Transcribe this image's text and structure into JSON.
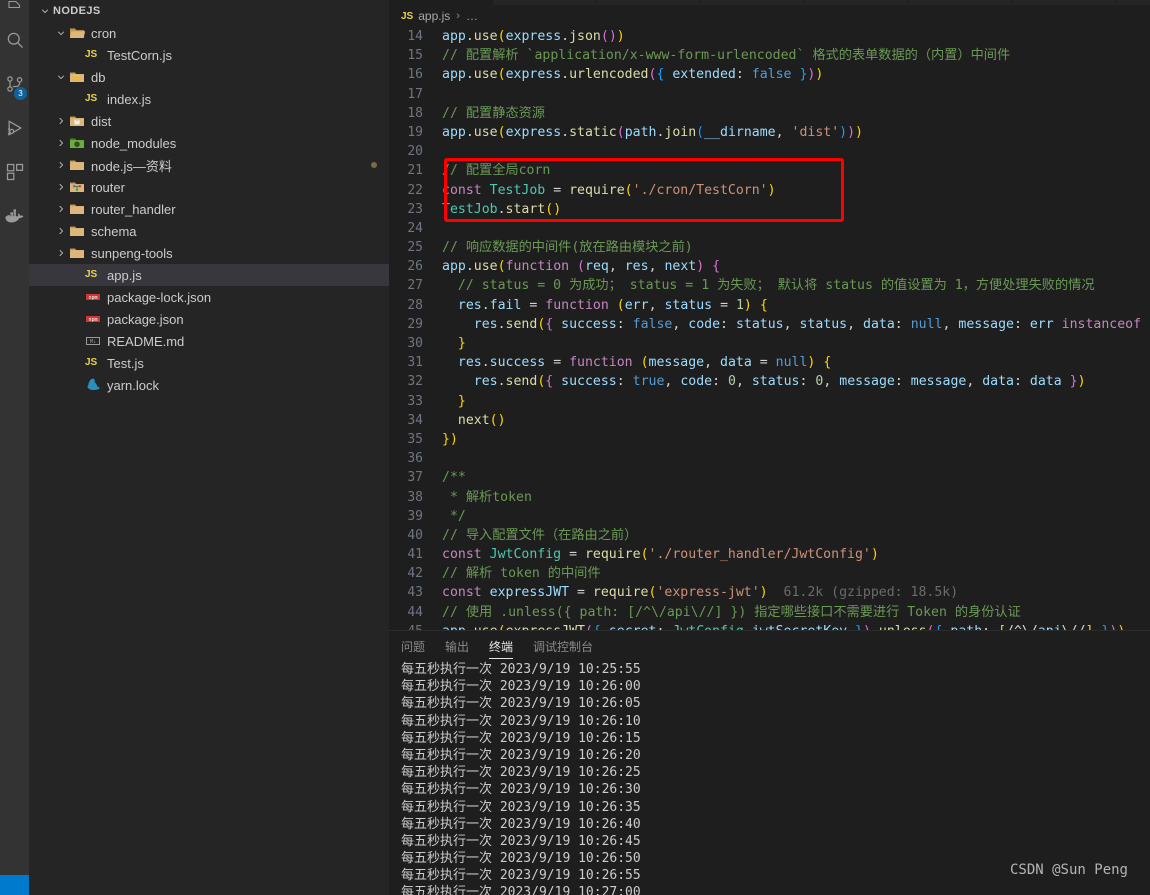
{
  "activity_bar": {
    "items": [
      {
        "name": "explorer-icon",
        "glyph": "files"
      },
      {
        "name": "search-icon",
        "glyph": "search"
      },
      {
        "name": "source-control-icon",
        "glyph": "git",
        "badge": "3"
      },
      {
        "name": "run-debug-icon",
        "glyph": "debug"
      },
      {
        "name": "extensions-icon",
        "glyph": "extensions"
      },
      {
        "name": "docker-icon",
        "glyph": "docker"
      }
    ]
  },
  "sidebar": {
    "section_title": "NODEJS",
    "tree": [
      {
        "label": "cron",
        "type": "folder",
        "expanded": true,
        "indent": 1,
        "icon": "folder-open-icon"
      },
      {
        "label": "TestCorn.js",
        "type": "js",
        "indent": 2,
        "icon": "js-icon"
      },
      {
        "label": "db",
        "type": "folder",
        "expanded": true,
        "indent": 1,
        "icon": "folder-db-icon"
      },
      {
        "label": "index.js",
        "type": "js",
        "indent": 2,
        "icon": "js-icon"
      },
      {
        "label": "dist",
        "type": "folder",
        "expanded": false,
        "indent": 1,
        "icon": "folder-dist-icon"
      },
      {
        "label": "node_modules",
        "type": "folder",
        "expanded": false,
        "indent": 1,
        "icon": "folder-node-icon"
      },
      {
        "label": "node.js—资料",
        "type": "folder",
        "expanded": false,
        "indent": 1,
        "icon": "folder-icon",
        "dot": true
      },
      {
        "label": "router",
        "type": "folder",
        "expanded": false,
        "indent": 1,
        "icon": "folder-router-icon"
      },
      {
        "label": "router_handler",
        "type": "folder",
        "expanded": false,
        "indent": 1,
        "icon": "folder-icon"
      },
      {
        "label": "schema",
        "type": "folder",
        "expanded": false,
        "indent": 1,
        "icon": "folder-icon"
      },
      {
        "label": "sunpeng-tools",
        "type": "folder",
        "expanded": false,
        "indent": 1,
        "icon": "folder-icon"
      },
      {
        "label": "app.js",
        "type": "js",
        "indent": 2,
        "icon": "js-icon",
        "selected": true
      },
      {
        "label": "package-lock.json",
        "type": "npm",
        "indent": 2,
        "icon": "npm-icon"
      },
      {
        "label": "package.json",
        "type": "npm",
        "indent": 2,
        "icon": "npm-icon"
      },
      {
        "label": "README.md",
        "type": "md",
        "indent": 2,
        "icon": "markdown-icon"
      },
      {
        "label": "Test.js",
        "type": "js",
        "indent": 2,
        "icon": "js-icon"
      },
      {
        "label": "yarn.lock",
        "type": "yarn",
        "indent": 2,
        "icon": "yarn-icon"
      }
    ]
  },
  "editor": {
    "breadcrumb": {
      "file_icon": "JS",
      "file": "app.js",
      "separator": "›",
      "rest": "…"
    },
    "first_line_number": 14,
    "lines": [
      {
        "n": 14,
        "text": "app.use(express.json())"
      },
      {
        "n": 15,
        "text": "// 配置解析 `application/x-www-form-urlencoded` 格式的表单数据的（内置）中间件"
      },
      {
        "n": 16,
        "text": "app.use(express.urlencoded({ extended: false }))"
      },
      {
        "n": 17,
        "text": ""
      },
      {
        "n": 18,
        "text": "// 配置静态资源"
      },
      {
        "n": 19,
        "text": "app.use(express.static(path.join(__dirname, 'dist')))"
      },
      {
        "n": 20,
        "text": ""
      },
      {
        "n": 21,
        "text": "// 配置全局corn"
      },
      {
        "n": 22,
        "text": "const TestJob = require('./cron/TestCorn')"
      },
      {
        "n": 23,
        "text": "TestJob.start()"
      },
      {
        "n": 24,
        "text": ""
      },
      {
        "n": 25,
        "text": "// 响应数据的中间件(放在路由模块之前)"
      },
      {
        "n": 26,
        "text": "app.use(function (req, res, next) {"
      },
      {
        "n": 27,
        "text": "  // status = 0 为成功； status = 1 为失败； 默认将 status 的值设置为 1，方便处理失败的情况"
      },
      {
        "n": 28,
        "text": "  res.fail = function (err, status = 1) {"
      },
      {
        "n": 29,
        "text": "    res.send({ success: false, code: status, status, data: null, message: err instanceof E"
      },
      {
        "n": 30,
        "text": "  }"
      },
      {
        "n": 31,
        "text": "  res.success = function (message, data = null) {"
      },
      {
        "n": 32,
        "text": "    res.send({ success: true, code: 0, status: 0, message: message, data: data })"
      },
      {
        "n": 33,
        "text": "  }"
      },
      {
        "n": 34,
        "text": "  next()"
      },
      {
        "n": 35,
        "text": "})"
      },
      {
        "n": 36,
        "text": ""
      },
      {
        "n": 37,
        "text": "/**"
      },
      {
        "n": 38,
        "text": " * 解析token"
      },
      {
        "n": 39,
        "text": " */"
      },
      {
        "n": 40,
        "text": "// 导入配置文件（在路由之前）"
      },
      {
        "n": 41,
        "text": "const JwtConfig = require('./router_handler/JwtConfig')"
      },
      {
        "n": 42,
        "text": "// 解析 token 的中间件"
      },
      {
        "n": 43,
        "text": "const expressJWT = require('express-jwt')  61.2k (gzipped: 18.5k)"
      },
      {
        "n": 44,
        "text": "// 使用 .unless({ path: [/^\\/api\\//] }) 指定哪些接口不需要进行 Token 的身份认证"
      },
      {
        "n": 45,
        "text": "app.use(expressJWT({ secret: JwtConfig.jwtSecretKey }).unless({ path: [/^\\/api\\//] }))"
      }
    ],
    "annotation": {
      "name": "red-highlight-box",
      "color": "#ff0000",
      "covers_lines": "21-23"
    }
  },
  "panel": {
    "tabs": [
      {
        "label": "问题",
        "active": false
      },
      {
        "label": "输出",
        "active": false
      },
      {
        "label": "终端",
        "active": true
      },
      {
        "label": "调试控制台",
        "active": false
      }
    ],
    "terminal_lines": [
      "每五秒执行一次 2023/9/19 10:25:55",
      "每五秒执行一次 2023/9/19 10:26:00",
      "每五秒执行一次 2023/9/19 10:26:05",
      "每五秒执行一次 2023/9/19 10:26:10",
      "每五秒执行一次 2023/9/19 10:26:15",
      "每五秒执行一次 2023/9/19 10:26:20",
      "每五秒执行一次 2023/9/19 10:26:25",
      "每五秒执行一次 2023/9/19 10:26:30",
      "每五秒执行一次 2023/9/19 10:26:35",
      "每五秒执行一次 2023/9/19 10:26:40",
      "每五秒执行一次 2023/9/19 10:26:45",
      "每五秒执行一次 2023/9/19 10:26:50",
      "每五秒执行一次 2023/9/19 10:26:55",
      "每五秒执行一次 2023/9/19 10:27:00"
    ]
  },
  "watermark": {
    "text": "CSDN @Sun  Peng"
  },
  "colors": {
    "activity_bar_bg": "#333333",
    "sidebar_bg": "#252526",
    "editor_bg": "#1e1e1e",
    "selection_bg": "#37373d",
    "accent": "#007acc",
    "annotation_red": "#ff0000",
    "badge_blue": "#0e639c"
  }
}
